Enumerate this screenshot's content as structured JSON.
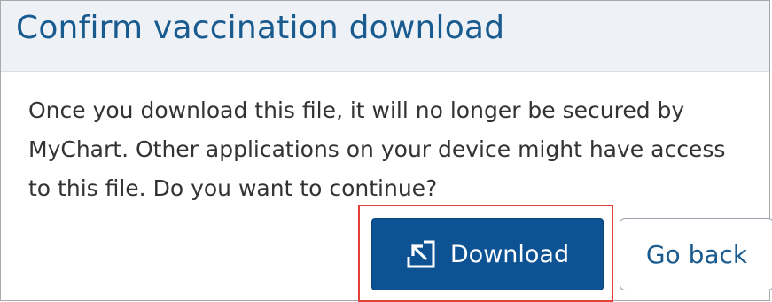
{
  "dialog": {
    "title": "Confirm vaccination download",
    "message": "Once you download this file, it will no longer be secured by MyChart. Other applications on your device might have access to this file. Do you want to continue?",
    "buttons": {
      "download_label": "Download",
      "download_icon": "download-arrow-icon",
      "go_back_label": "Go back"
    }
  },
  "colors": {
    "title": "#1a5b8f",
    "header_bg": "#eef2f7",
    "primary_button": "#0d5394",
    "highlight_box": "#e3413a"
  }
}
